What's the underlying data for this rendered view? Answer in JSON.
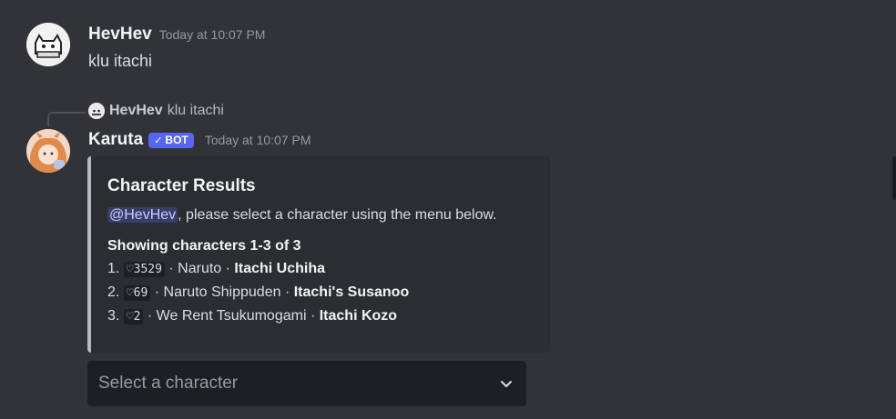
{
  "messages": [
    {
      "username": "HevHev",
      "timestamp": "Today at 10:07 PM",
      "text": "klu itachi"
    },
    {
      "reply": {
        "username": "HevHev",
        "text": "klu itachi"
      },
      "username": "Karuta",
      "badge": "BOT",
      "timestamp": "Today at 10:07 PM",
      "embed": {
        "title": "Character Results",
        "mention": "@HevHev",
        "description_rest": ", please select a character using the menu below.",
        "showing": "Showing characters 1-3 of 3",
        "results": [
          {
            "index": "1.",
            "wishlist": "♡3529",
            "series": "· Naruto ·",
            "name": "Itachi Uchiha"
          },
          {
            "index": "2.",
            "wishlist": "♡69",
            "series": "· Naruto Shippuden ·",
            "name": "Itachi's Susanoo"
          },
          {
            "index": "3.",
            "wishlist": "♡2",
            "series": "· We Rent Tsukumogami ·",
            "name": "Itachi Kozo"
          }
        ],
        "accent_color": "#b5bac1"
      },
      "select": {
        "placeholder": "Select a character",
        "icon": "chevron-down-icon"
      }
    }
  ]
}
